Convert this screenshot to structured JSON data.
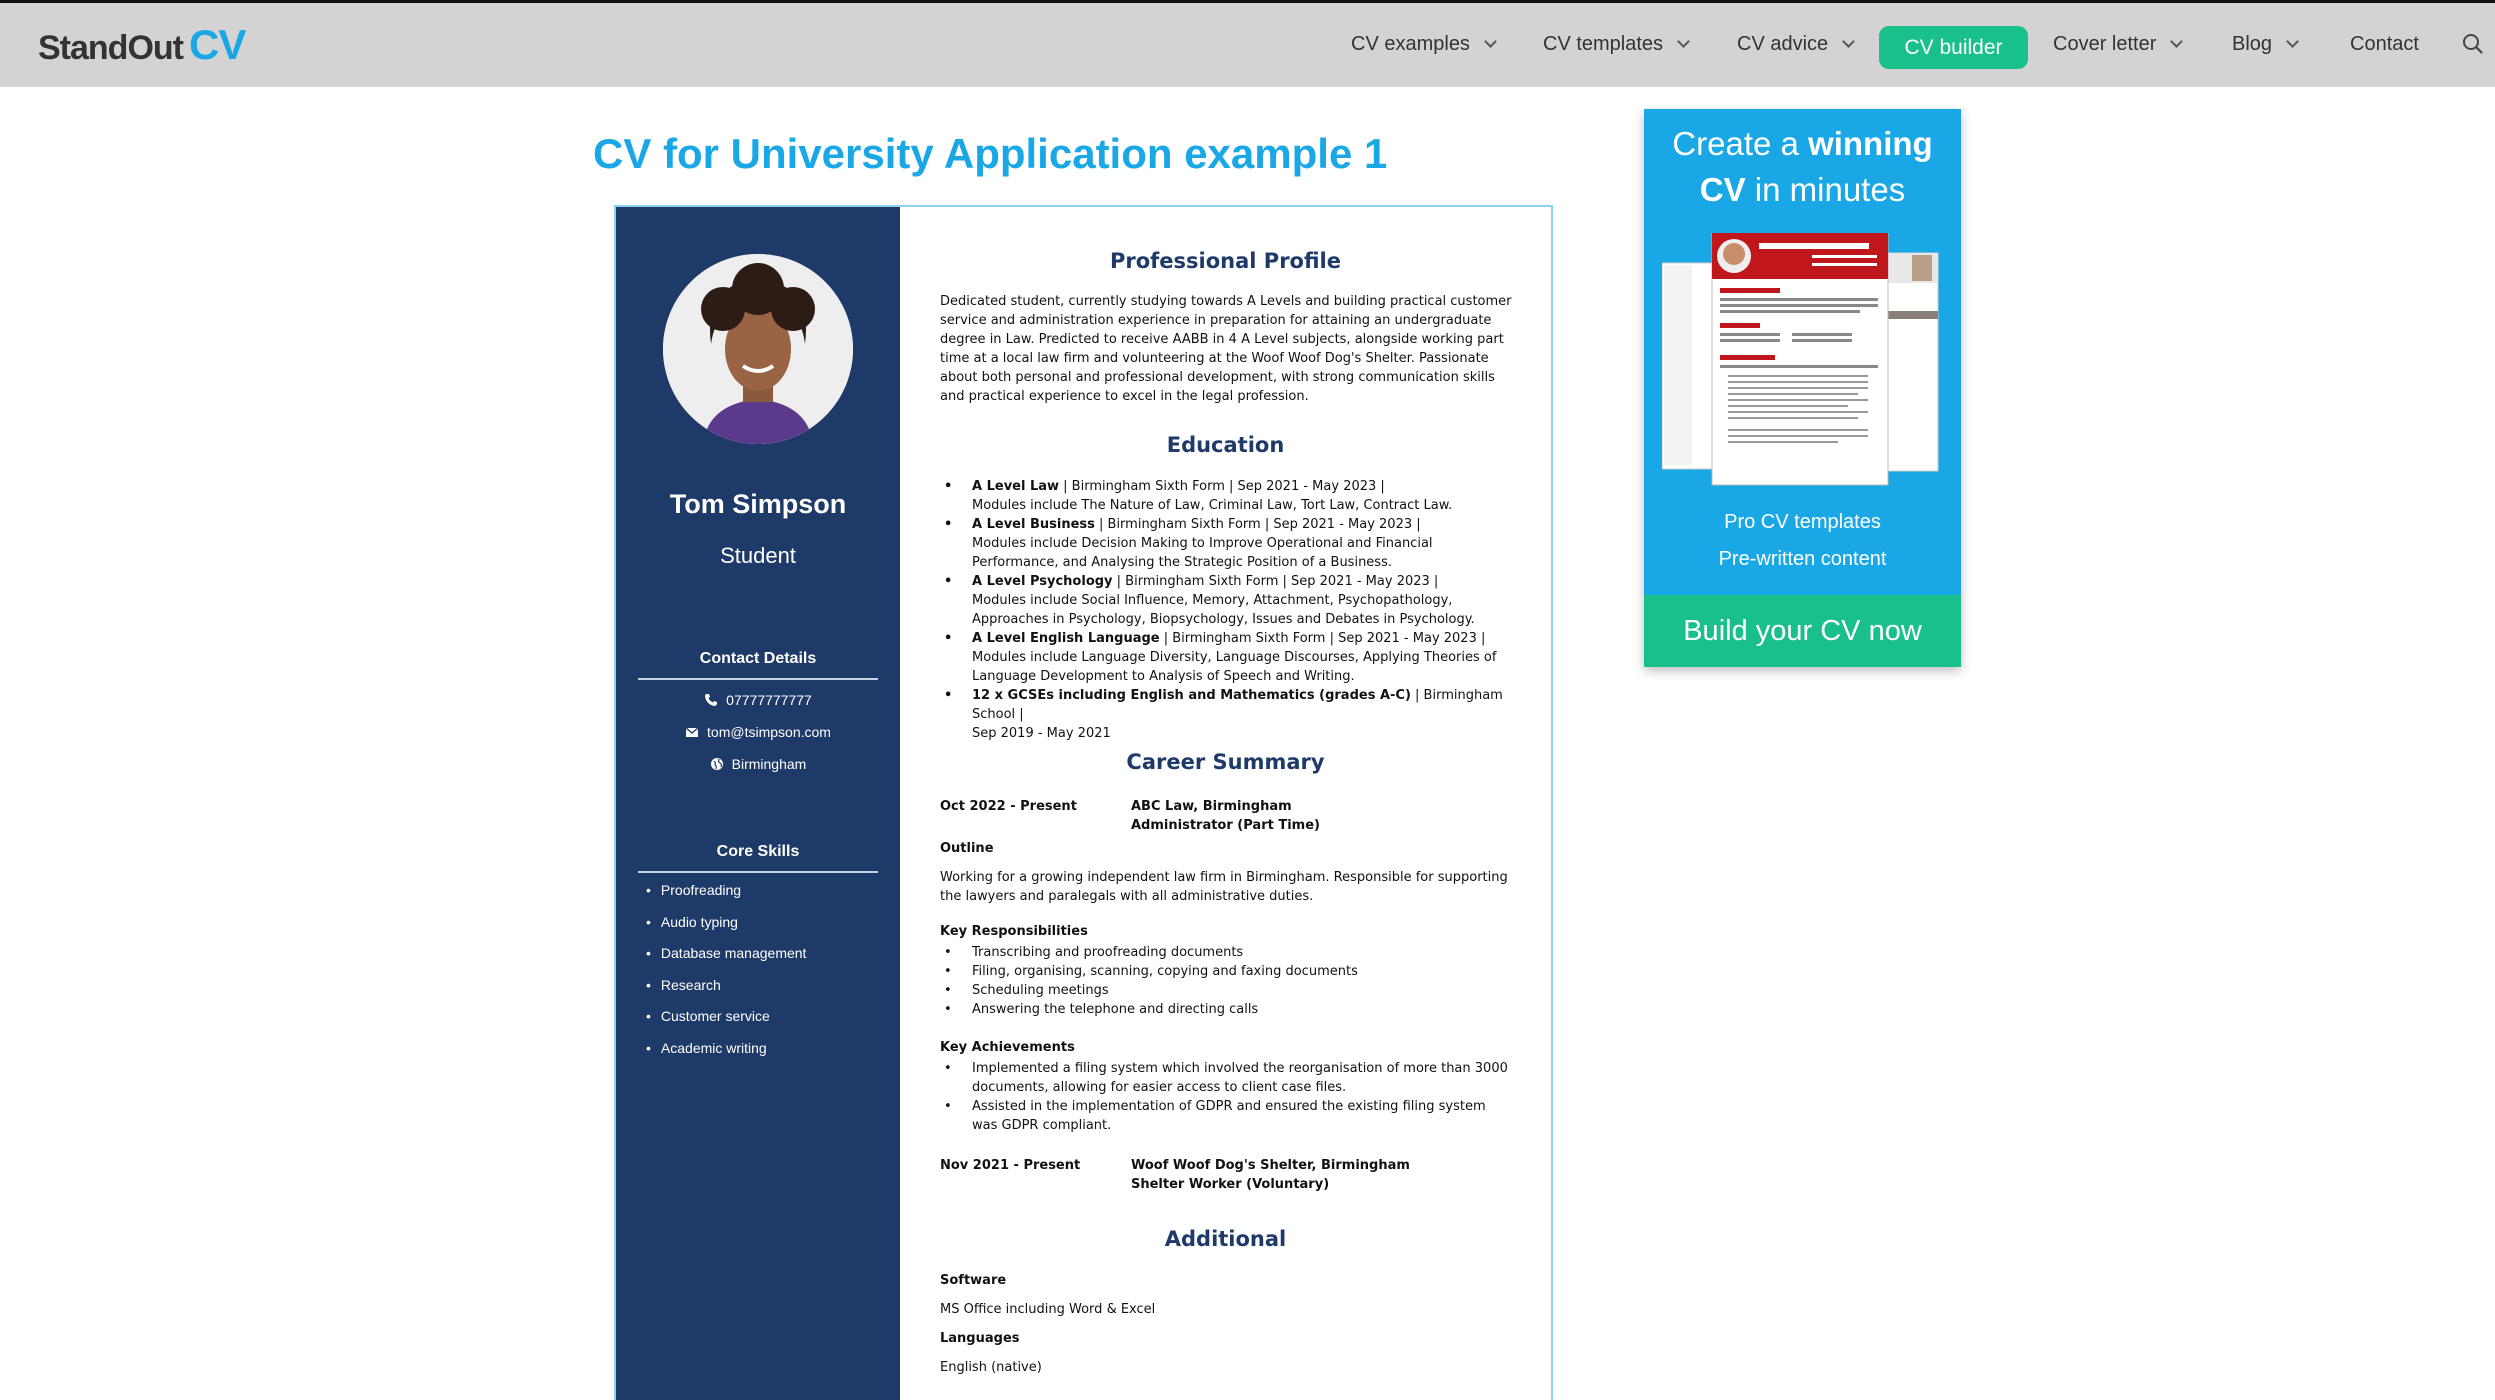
{
  "logo": {
    "part1": "StandOut",
    "part2": "CV"
  },
  "nav": {
    "items": [
      {
        "label": "CV examples"
      },
      {
        "label": "CV templates"
      },
      {
        "label": "CV advice"
      },
      {
        "label": "CV builder"
      },
      {
        "label": "Cover letter"
      },
      {
        "label": "Blog"
      },
      {
        "label": "Contact"
      }
    ],
    "accent": "#19c08b"
  },
  "page": {
    "title": "CV for University Application example 1"
  },
  "cv": {
    "name": "Tom Simpson",
    "role": "Student",
    "contact_heading": "Contact Details",
    "phone": "07777777777",
    "email": "tom@tsimpson.com",
    "location": "Birmingham",
    "skills_heading": "Core Skills",
    "skills": [
      "Proofreading",
      "Audio typing",
      "Database management",
      "Research",
      "Customer service",
      "Academic writing"
    ],
    "profile_heading": "Professional Profile",
    "profile_text": "Dedicated student, currently studying towards A Levels and building practical customer service and administration experience in preparation for attaining an undergraduate degree in Law. Predicted to receive AABB in 4 A Level subjects, alongside working part time at a local law firm and volunteering at the Woof Woof Dog's Shelter. Passionate about both personal and professional development, with strong communication skills and practical experience to excel in the legal profession.",
    "education_heading": "Education",
    "education": [
      {
        "title": "A Level Law",
        "rest": " | Birmingham Sixth Form | Sep 2021 - May 2023 |",
        "detail": "Modules include The Nature of Law, Criminal Law, Tort Law, Contract Law."
      },
      {
        "title": "A Level Business",
        "rest": " | Birmingham Sixth Form | Sep 2021 - May 2023 |",
        "detail": "Modules include Decision Making to Improve Operational and Financial Performance, and Analysing the Strategic Position of a Business."
      },
      {
        "title": "A Level Psychology",
        "rest": " | Birmingham Sixth Form | Sep 2021 - May 2023 |",
        "detail": "Modules include Social Influence, Memory, Attachment, Psychopathology, Approaches in Psychology, Biopsychology, Issues and Debates in Psychology."
      },
      {
        "title": "A Level English Language",
        "rest": " | Birmingham Sixth Form | Sep 2021 - May 2023 |",
        "detail": "Modules include Language Diversity, Language Discourses, Applying Theories of Language Development to Analysis of Speech and Writing."
      },
      {
        "title": "12 x GCSEs including English and Mathematics (grades A-C)",
        "rest": " | Birmingham School |",
        "detail": "Sep 2019 - May 2021"
      }
    ],
    "career_heading": "Career Summary",
    "job1": {
      "dates": "Oct 2022 - Present",
      "employer": "ABC Law, Birmingham",
      "title": "Administrator (Part Time)"
    },
    "outline_label": "Outline",
    "outline_text": "Working for a growing independent law firm in Birmingham. Responsible for supporting the lawyers and paralegals with all administrative duties.",
    "resp_label": "Key Responsibilities",
    "responsibilities": [
      "Transcribing and proofreading documents",
      "Filing, organising, scanning, copying and faxing documents",
      "Scheduling meetings",
      "Answering the telephone and directing calls"
    ],
    "ach_label": "Key Achievements",
    "achievements": [
      "Implemented a filing system which involved the reorganisation of more than 3000 documents, allowing for easier access to client case files.",
      "Assisted in the implementation of GDPR and ensured the existing filing system was GDPR compliant."
    ],
    "job2": {
      "dates": "Nov 2021 - Present",
      "employer": "Woof Woof Dog's Shelter, Birmingham",
      "title": "Shelter Worker (Voluntary)"
    },
    "additional_heading": "Additional",
    "software_label": "Software",
    "software": "MS Office including Word & Excel",
    "languages_label": "Languages",
    "languages": "English (native)"
  },
  "promo": {
    "title_pre": "Create a ",
    "title_bold1": "winning",
    "title_bold2": "CV",
    "title_post": " in minutes",
    "feature1": "Pro CV templates",
    "feature2": "Pre-written content",
    "button": "Build your CV now"
  },
  "colors": {
    "brand_blue": "#1aa7e6",
    "navy": "#1e3a68",
    "green": "#19c08b"
  }
}
